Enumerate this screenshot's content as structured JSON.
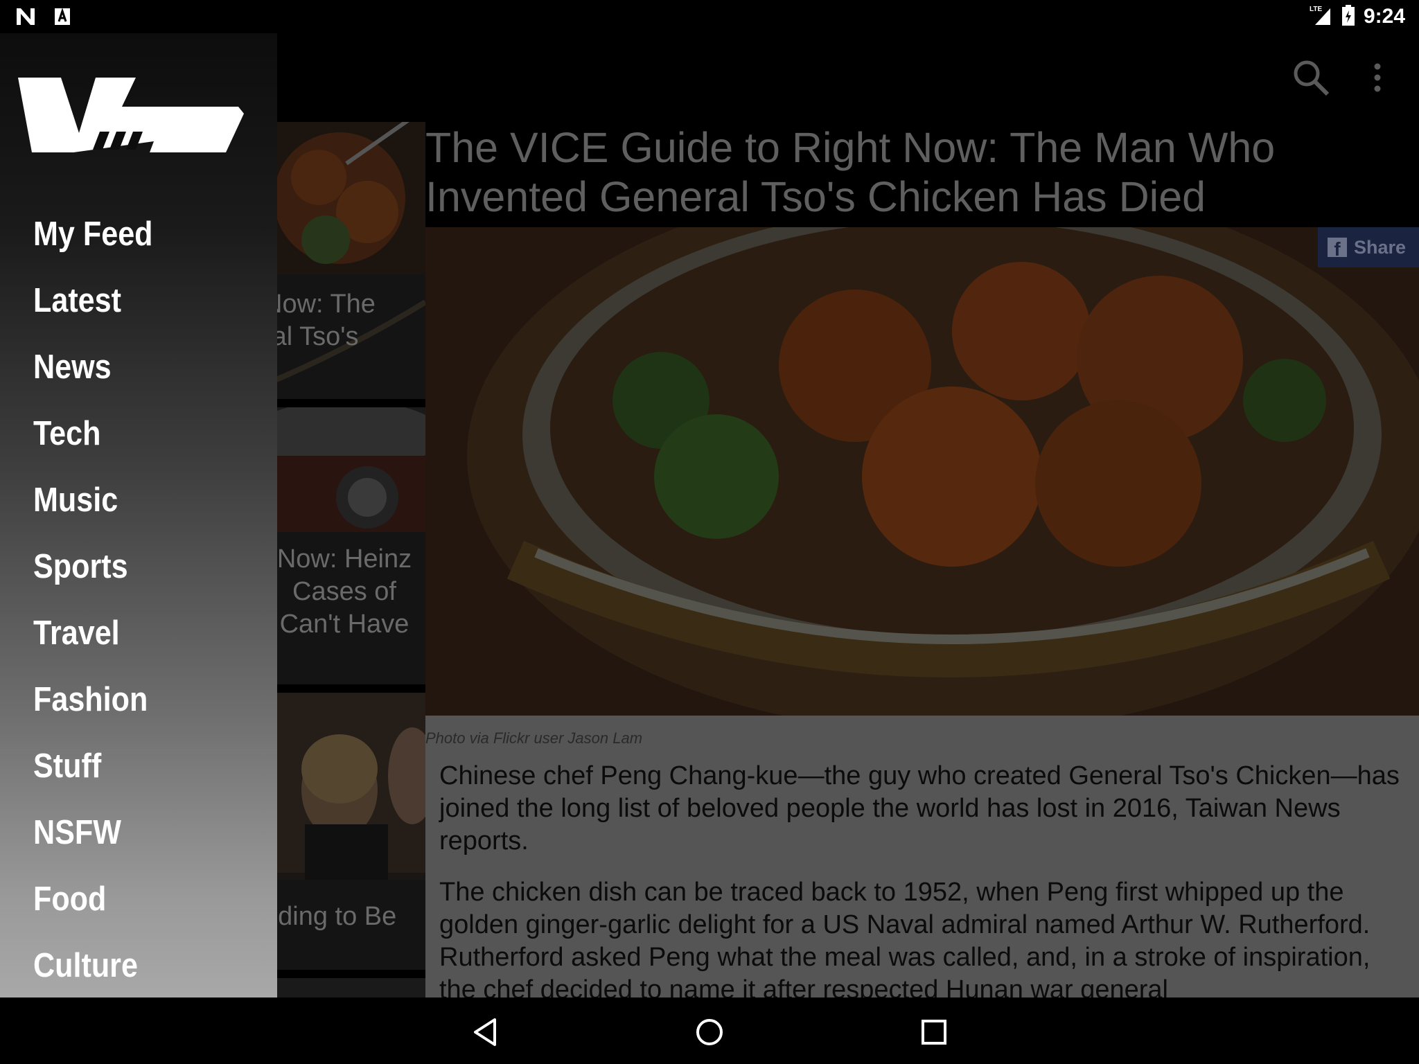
{
  "status_bar": {
    "left_icons": [
      "n-app-icon",
      "a-app-icon"
    ],
    "network": "LTE",
    "time": "9:24"
  },
  "toolbar": {
    "icons": [
      "search-icon",
      "more-vert-icon"
    ]
  },
  "article": {
    "title": "The VICE Guide to Right Now: The Man Who Invented General Tso's Chicken Has Died",
    "share_label": "Share",
    "photo_caption": "Photo via Flickr user Jason Lam",
    "paragraphs": [
      "Chinese chef Peng Chang-kue—the guy who created General Tso's Chicken—has joined the long list of beloved people the world has lost in 2016, Taiwan News reports.",
      "The chicken dish can be traced back to 1952, when Peng first whipped up the golden ginger-garlic delight for a US Naval admiral named Arthur W. Rutherford. Rutherford asked Peng what the meal was called, and, in a stroke of inspiration, the chef decided to name it after respected Hunan war general"
    ]
  },
  "article_list": [
    {
      "title_lines": [
        "Now: The",
        "ral Tso's"
      ]
    },
    {
      "title_lines": [
        "Now: Heinz",
        "Cases of",
        "Can't Have"
      ]
    },
    {
      "title_lines": [
        "nding to Be"
      ]
    }
  ],
  "drawer": {
    "logo_text": "VICE",
    "items": [
      "My Feed",
      "Latest",
      "News",
      "Tech",
      "Music",
      "Sports",
      "Travel",
      "Fashion",
      "Stuff",
      "NSFW",
      "Food",
      "Culture"
    ]
  },
  "nav_bar": {
    "buttons": [
      "back-icon",
      "home-icon",
      "recents-icon"
    ]
  },
  "colors": {
    "scrim": "#000000",
    "share_bg": "#1a2440",
    "body_bg": "#555555"
  }
}
